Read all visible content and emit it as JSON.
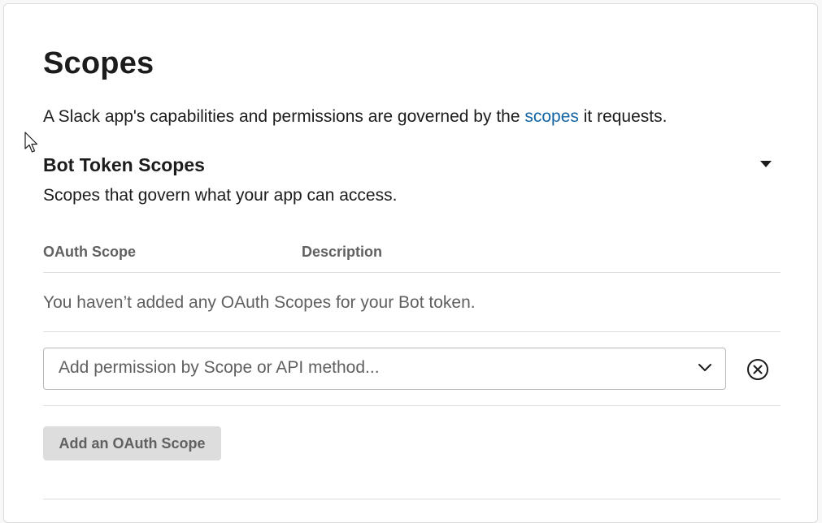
{
  "page": {
    "title": "Scopes",
    "intro_before": "A Slack app's capabilities and permissions are governed by the ",
    "intro_link": "scopes",
    "intro_after": " it requests."
  },
  "bot_scopes": {
    "title": "Bot Token Scopes",
    "subtitle": "Scopes that govern what your app can access.",
    "collapse_icon": "caret-down-icon",
    "table": {
      "columns": [
        "OAuth Scope",
        "Description"
      ],
      "empty_message": "You haven’t added any OAuth Scopes for your Bot token."
    },
    "select": {
      "placeholder": "Add permission by Scope or API method...",
      "chevron_icon": "chevron-down-icon",
      "clear_icon": "close-circle-icon"
    },
    "add_button_label": "Add an OAuth Scope"
  },
  "colors": {
    "link": "#1264a3",
    "text": "#1d1c1d",
    "muted": "#616061",
    "divider": "#dddddd",
    "button_bg": "#dddddd"
  }
}
